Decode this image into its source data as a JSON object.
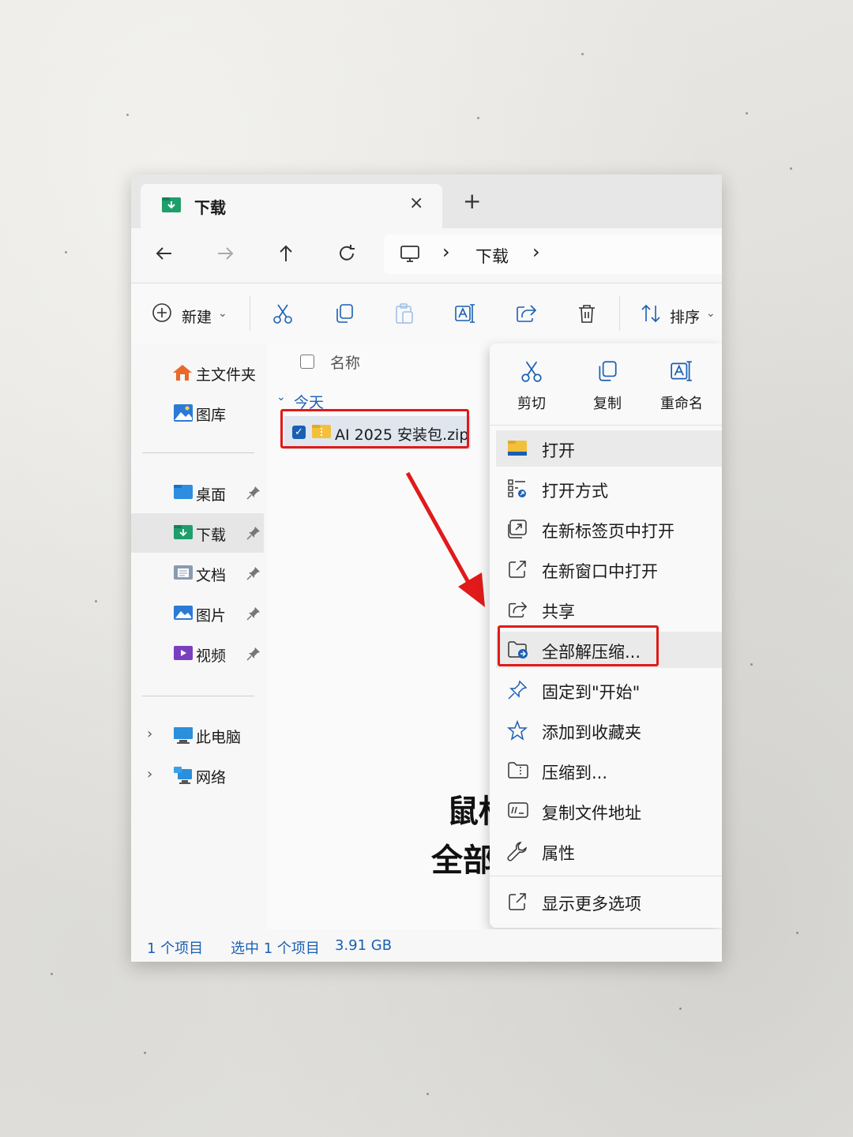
{
  "window": {
    "tab_title": "下载",
    "tab_close": "×",
    "new_tab": "+"
  },
  "address": {
    "crumbs": [
      "下载"
    ],
    "separator": "›"
  },
  "toolbar": {
    "new_label": "新建",
    "sort_label": "排序",
    "dropdown": "⌄"
  },
  "sidebar": {
    "top": [
      "主文件夹",
      "图库"
    ],
    "pinned": [
      "桌面",
      "下载",
      "文档",
      "图片",
      "视频"
    ],
    "bottom": [
      "此电脑",
      "网络"
    ]
  },
  "main": {
    "column_name": "名称",
    "group": "今天",
    "file_name": "AI 2025 安装包.zip",
    "caption_line1": "鼠标右键",
    "caption_line2": "全部解压缩"
  },
  "status": {
    "count": "1 个项目",
    "selected": "选中 1 个项目",
    "size": "3.91 GB"
  },
  "context_menu": {
    "quick_actions": [
      "剪切",
      "复制",
      "重命名"
    ],
    "items": [
      "打开",
      "打开方式",
      "在新标签页中打开",
      "在新窗口中打开",
      "共享",
      "全部解压缩...",
      "固定到\"开始\"",
      "添加到收藏夹",
      "压缩到...",
      "复制文件地址",
      "属性"
    ],
    "more": "显示更多选项"
  },
  "colors": {
    "accent": "#1a5fb4",
    "highlight_red": "#e11a1a",
    "folder_yellow": "#f3c03c"
  }
}
